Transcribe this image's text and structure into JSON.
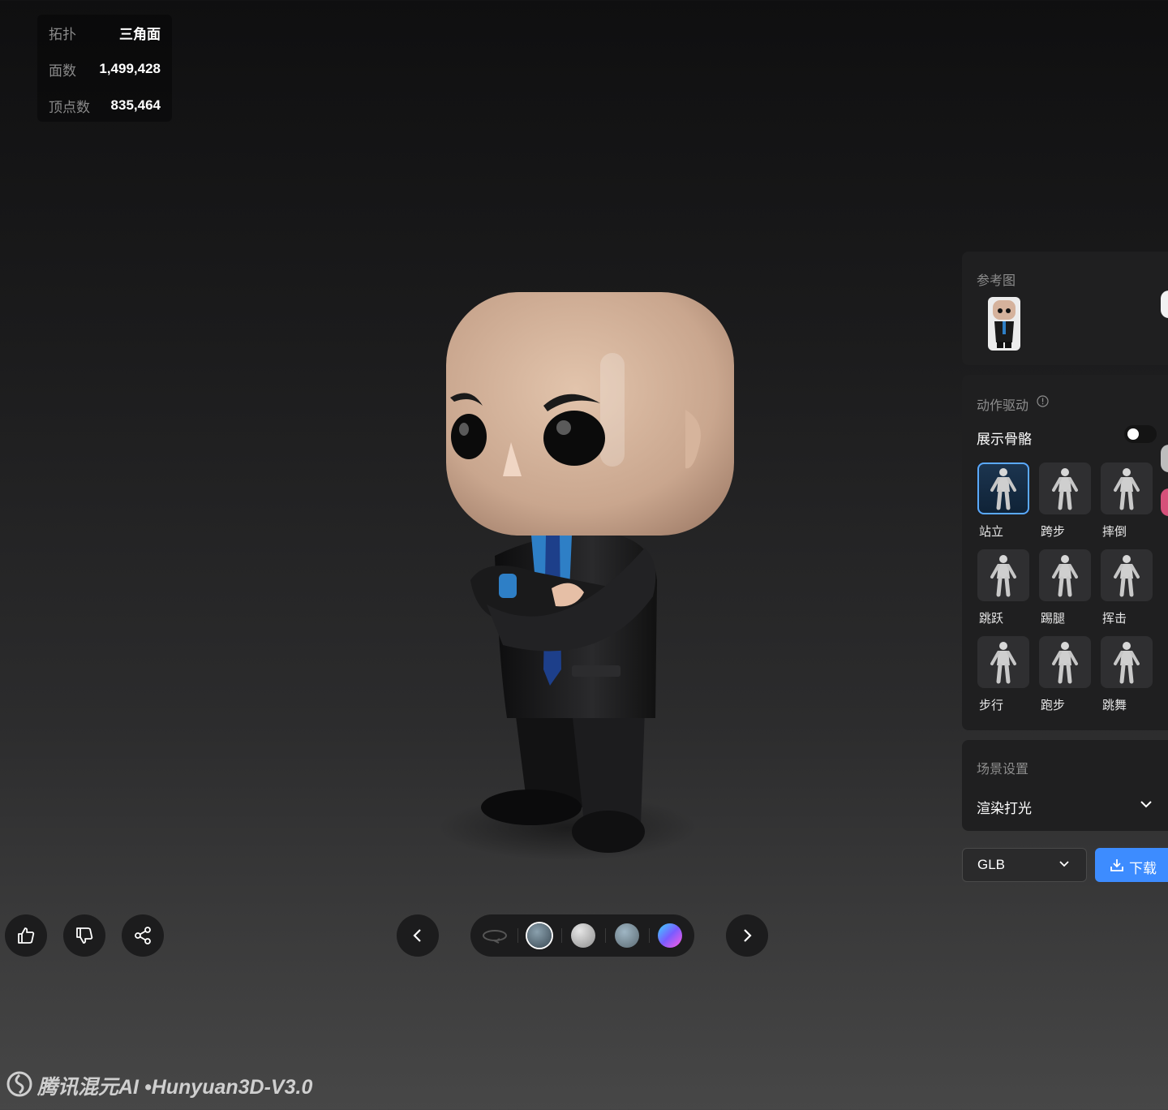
{
  "stats": [
    {
      "key": "拓扑",
      "value": "三角面"
    },
    {
      "key": "面数",
      "value": "1,499,428"
    },
    {
      "key": "顶点数",
      "value": "835,464"
    }
  ],
  "reference": {
    "title": "参考图"
  },
  "motion": {
    "title": "动作驱动",
    "info_icon": "info-circle-icon",
    "show_skeleton_label": "展示骨骼",
    "show_skeleton_on": false,
    "actions": [
      "站立",
      "跨步",
      "摔倒",
      "跳跃",
      "踢腿",
      "挥击",
      "步行",
      "跑步",
      "跳舞"
    ],
    "selected_index": 0
  },
  "scene": {
    "title": "场景设置",
    "lighting_value": "渲染打光"
  },
  "export": {
    "format": "GLB",
    "download_label": "下载"
  },
  "feedback": {
    "like_icon": "thumbs-up-icon",
    "dislike_icon": "thumbs-down-icon",
    "share_icon": "share-icon"
  },
  "viewer": {
    "prev_icon": "chevron-left-icon",
    "next_icon": "chevron-right-icon",
    "rotate_icon": "rotate-icon",
    "materials": [
      "textured",
      "white-clay",
      "normal-map",
      "gradient"
    ],
    "selected_material": 0
  },
  "watermark": "腾讯混元AI •Hunyuan3D-V3.0",
  "colors": {
    "accent": "#3d8cff",
    "panel": "#1f1f20"
  }
}
